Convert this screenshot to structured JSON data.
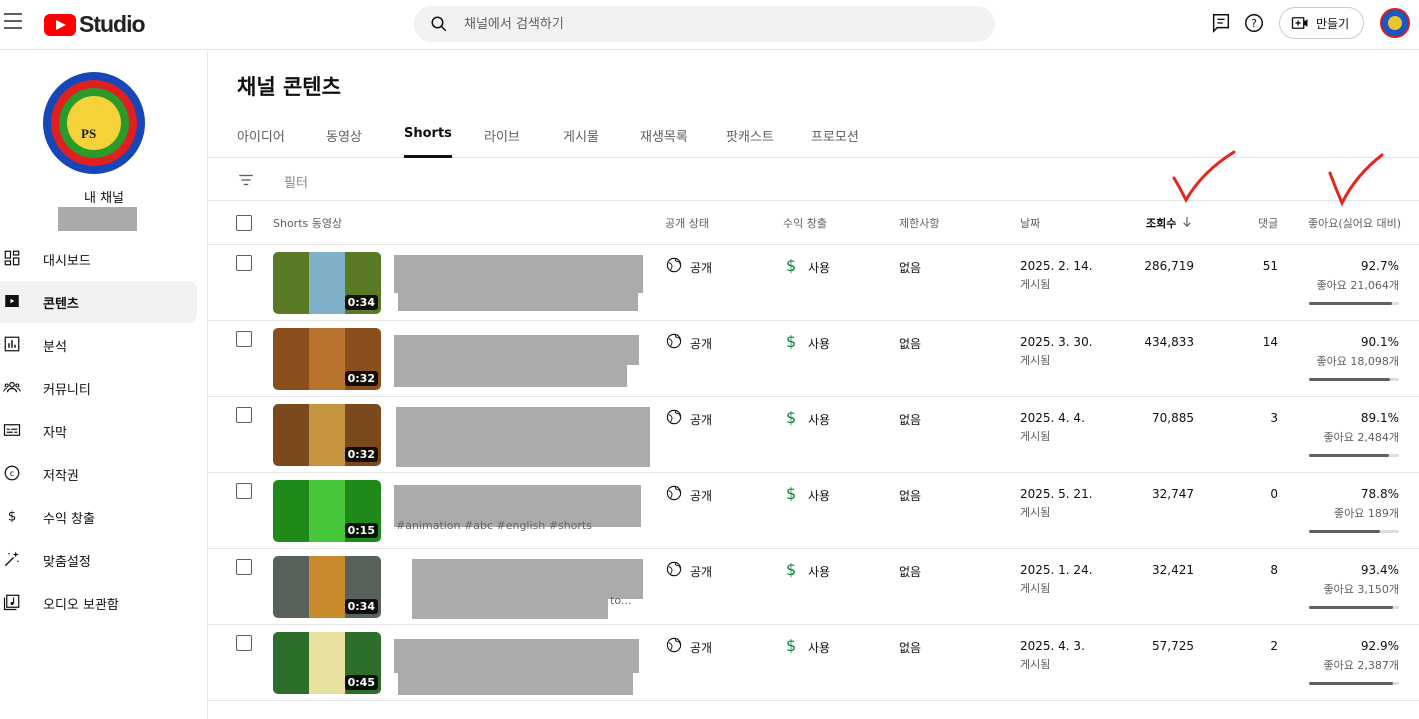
{
  "topbar": {
    "logo_text": "Studio",
    "search_placeholder": "채널에서 검색하기",
    "create_label": "만들기"
  },
  "sidebar": {
    "channel_name": "내 채널",
    "items": [
      {
        "label": "대시보드",
        "icon": "dashboard-icon"
      },
      {
        "label": "콘텐츠",
        "icon": "content-icon",
        "active": true
      },
      {
        "label": "분석",
        "icon": "analytics-icon"
      },
      {
        "label": "커뮤니티",
        "icon": "community-icon"
      },
      {
        "label": "자막",
        "icon": "subtitles-icon"
      },
      {
        "label": "저작권",
        "icon": "copyright-icon"
      },
      {
        "label": "수익 창출",
        "icon": "monetization-icon"
      },
      {
        "label": "맞춤설정",
        "icon": "customization-icon"
      },
      {
        "label": "오디오 보관함",
        "icon": "audio-library-icon"
      }
    ]
  },
  "main": {
    "title": "채널 콘텐츠",
    "tabs": [
      "아이디어",
      "동영상",
      "Shorts",
      "라이브",
      "게시물",
      "재생목록",
      "팟캐스트",
      "프로모션"
    ],
    "active_tab": "Shorts",
    "filter_label": "필터",
    "columns": {
      "video": "Shorts 동영상",
      "visibility": "공개 상태",
      "monetization": "수익 창출",
      "restrictions": "제한사항",
      "date": "날짜",
      "views": "조회수",
      "comments": "댓글",
      "likes": "좋아요(싫어요 대비)"
    },
    "rows": [
      {
        "duration": "0:34",
        "visibility": "공개",
        "monetization": "사용",
        "restrictions": "없음",
        "date": "2025. 2. 14.",
        "date_status": "게시됨",
        "views": "286,719",
        "comments": "51",
        "like_pct": "92.7%",
        "like_count": "좋아요 21,064개",
        "like_ratio": 0.927
      },
      {
        "duration": "0:32",
        "visibility": "공개",
        "monetization": "사용",
        "restrictions": "없음",
        "date": "2025. 3. 30.",
        "date_status": "게시됨",
        "views": "434,833",
        "comments": "14",
        "like_pct": "90.1%",
        "like_count": "좋아요 18,098개",
        "like_ratio": 0.901
      },
      {
        "duration": "0:32",
        "visibility": "공개",
        "monetization": "사용",
        "restrictions": "없음",
        "date": "2025. 4. 4.",
        "date_status": "게시됨",
        "views": "70,885",
        "comments": "3",
        "like_pct": "89.1%",
        "like_count": "좋아요 2,484개",
        "like_ratio": 0.891
      },
      {
        "duration": "0:15",
        "visibility": "공개",
        "monetization": "사용",
        "restrictions": "없음",
        "date": "2025. 5. 21.",
        "date_status": "게시됨",
        "views": "32,747",
        "comments": "0",
        "like_pct": "78.8%",
        "like_count": "좋아요 189개",
        "like_ratio": 0.788
      },
      {
        "duration": "0:34",
        "visibility": "공개",
        "monetization": "사용",
        "restrictions": "없음",
        "date": "2025. 1. 24.",
        "date_status": "게시됨",
        "views": "32,421",
        "comments": "8",
        "like_pct": "93.4%",
        "like_count": "좋아요 3,150개",
        "like_ratio": 0.934
      },
      {
        "duration": "0:45",
        "visibility": "공개",
        "monetization": "사용",
        "restrictions": "없음",
        "date": "2025. 4. 3.",
        "date_status": "게시됨",
        "views": "57,725",
        "comments": "2",
        "like_pct": "92.9%",
        "like_count": "좋아요 2,387개",
        "like_ratio": 0.929
      }
    ],
    "peek_texts": {
      "row4": "#animation #abc #english #shorts",
      "row5": "to..."
    }
  },
  "colors": {
    "brand_red": "#ff0000",
    "monetization_green": "#0a8a3a",
    "annotation_red": "#e8261e"
  }
}
